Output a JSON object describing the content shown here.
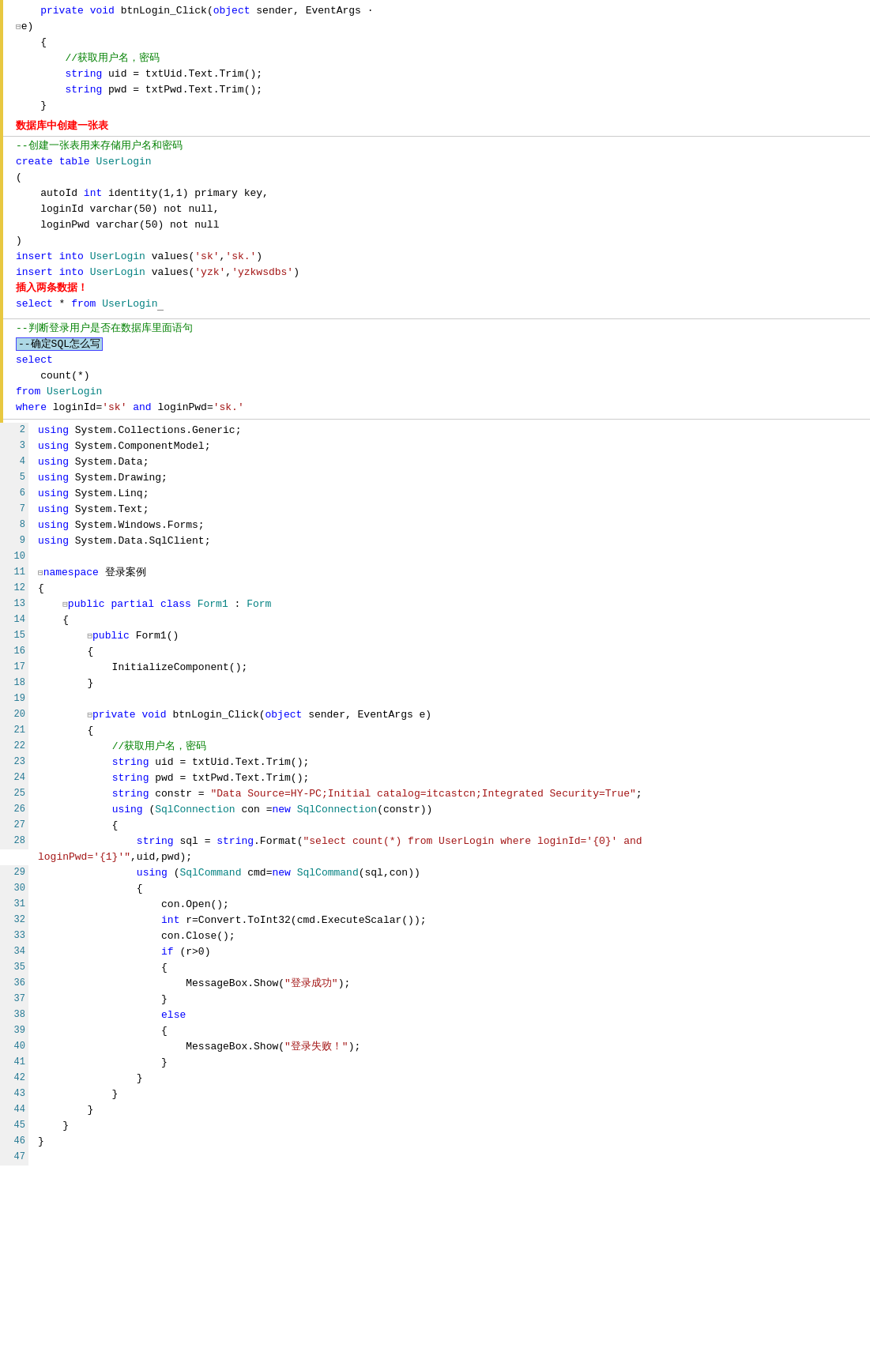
{
  "top_section": {
    "lines": [
      {
        "text": "    private void btnLogin_Click(object sender, EventArgs ·",
        "type": "mixed"
      },
      {
        "text": "⊟e)",
        "type": "normal"
      },
      {
        "text": "    {",
        "type": "normal"
      },
      {
        "text": "        //获取用户名，密码",
        "type": "comment"
      },
      {
        "text": "        string uid = txtUid.Text.Trim();",
        "type": "code"
      },
      {
        "text": "        string pwd = txtPwd.Text.Trim();",
        "type": "code"
      },
      {
        "text": "    }",
        "type": "normal"
      }
    ],
    "heading1": "数据库中创建一张表",
    "sql_comment1": "--创建一张表用来存储用户名和密码",
    "sql1": "create table UserLogin",
    "sql1b": "(",
    "sql1c": "    autoId int identity(1,1) primary key,",
    "sql1d": "    loginId varchar(50) not null,",
    "sql1e": "    loginPwd varchar(50) not null",
    "sql1f": ")",
    "sql2": "insert into UserLogin values('sk','sk.')",
    "sql3": "insert into UserLogin values('yzk','yzkwsdbs')",
    "heading2": "插入两条数据！",
    "sql4": "select * from UserLogin",
    "heading3": "--判断登录用户是否在数据库里面语句",
    "heading4": "--确定SQL怎么写",
    "sql5": "select",
    "sql5b": "    count(*)",
    "sql5c": "from UserLogin",
    "sql5d": "where loginId='sk' and loginPwd='sk.'"
  },
  "bottom_section": {
    "lines": [
      {
        "n": "2",
        "indent": 0,
        "content": "using System.Collections.Generic;"
      },
      {
        "n": "3",
        "indent": 0,
        "content": "using System.ComponentModel;"
      },
      {
        "n": "4",
        "indent": 0,
        "content": "using System.Data;"
      },
      {
        "n": "5",
        "indent": 0,
        "content": "using System.Drawing;"
      },
      {
        "n": "6",
        "indent": 0,
        "content": "using System.Linq;"
      },
      {
        "n": "7",
        "indent": 0,
        "content": "using System.Text;"
      },
      {
        "n": "8",
        "indent": 0,
        "content": "using System.Windows.Forms;"
      },
      {
        "n": "9",
        "indent": 0,
        "content": "using System.Data.SqlClient;"
      },
      {
        "n": "10",
        "indent": 0,
        "content": ""
      },
      {
        "n": "11",
        "indent": 0,
        "content": "⊟namespace 登录案例"
      },
      {
        "n": "12",
        "indent": 0,
        "content": "{"
      },
      {
        "n": "13",
        "indent": 1,
        "content": "    public partial class Form1 : Form"
      },
      {
        "n": "14",
        "indent": 1,
        "content": "    {"
      },
      {
        "n": "15",
        "indent": 2,
        "content": "        public Form1()"
      },
      {
        "n": "16",
        "indent": 2,
        "content": "        {"
      },
      {
        "n": "17",
        "indent": 3,
        "content": "            InitializeComponent();"
      },
      {
        "n": "18",
        "indent": 2,
        "content": "        }"
      },
      {
        "n": "19",
        "indent": 0,
        "content": ""
      },
      {
        "n": "20",
        "indent": 2,
        "content": "        private void btnLogin_Click(object sender, EventArgs e)"
      },
      {
        "n": "21",
        "indent": 2,
        "content": "        {"
      },
      {
        "n": "22",
        "indent": 3,
        "content": "            //获取用户名，密码"
      },
      {
        "n": "23",
        "indent": 3,
        "content": "            string uid = txtUid.Text.Trim();"
      },
      {
        "n": "24",
        "indent": 3,
        "content": "            string pwd = txtPwd.Text.Trim();"
      },
      {
        "n": "25",
        "indent": 3,
        "content": "            string constr = \"Data Source=HY-PC;Initial catalog=itcastcn;Integrated Security=True\";"
      },
      {
        "n": "26",
        "indent": 3,
        "content": "            using (SqlConnection con =new SqlConnection(constr))"
      },
      {
        "n": "27",
        "indent": 3,
        "content": "            {"
      },
      {
        "n": "28",
        "indent": 4,
        "content": "                string sql = string.Format(\"select count(*) from UserLogin where loginId='{0}' and"
      },
      {
        "n": "",
        "indent": 0,
        "content": "loginPwd='{1}'\",uid,pwd);"
      },
      {
        "n": "29",
        "indent": 4,
        "content": "                using (SqlCommand cmd=new SqlCommand(sql,con))"
      },
      {
        "n": "30",
        "indent": 4,
        "content": "                {"
      },
      {
        "n": "31",
        "indent": 5,
        "content": "                    con.Open();"
      },
      {
        "n": "32",
        "indent": 5,
        "content": "                    int r=Convert.ToInt32(cmd.ExecuteScalar());"
      },
      {
        "n": "33",
        "indent": 5,
        "content": "                    con.Close();"
      },
      {
        "n": "34",
        "indent": 5,
        "content": "                    if (r>0)"
      },
      {
        "n": "35",
        "indent": 5,
        "content": "                    {"
      },
      {
        "n": "36",
        "indent": 6,
        "content": "                        MessageBox.Show(\"登录成功\");"
      },
      {
        "n": "37",
        "indent": 5,
        "content": "                    }"
      },
      {
        "n": "38",
        "indent": 5,
        "content": "                    else"
      },
      {
        "n": "39",
        "indent": 5,
        "content": "                    {"
      },
      {
        "n": "40",
        "indent": 6,
        "content": "                        MessageBox.Show(\"登录失败！\");"
      },
      {
        "n": "41",
        "indent": 5,
        "content": "                    }"
      },
      {
        "n": "42",
        "indent": 4,
        "content": "                }"
      },
      {
        "n": "43",
        "indent": 3,
        "content": "            }"
      },
      {
        "n": "44",
        "indent": 2,
        "content": "        }"
      },
      {
        "n": "45",
        "indent": 1,
        "content": "    }"
      },
      {
        "n": "46",
        "indent": 0,
        "content": "}"
      },
      {
        "n": "47",
        "indent": 0,
        "content": ""
      }
    ]
  }
}
